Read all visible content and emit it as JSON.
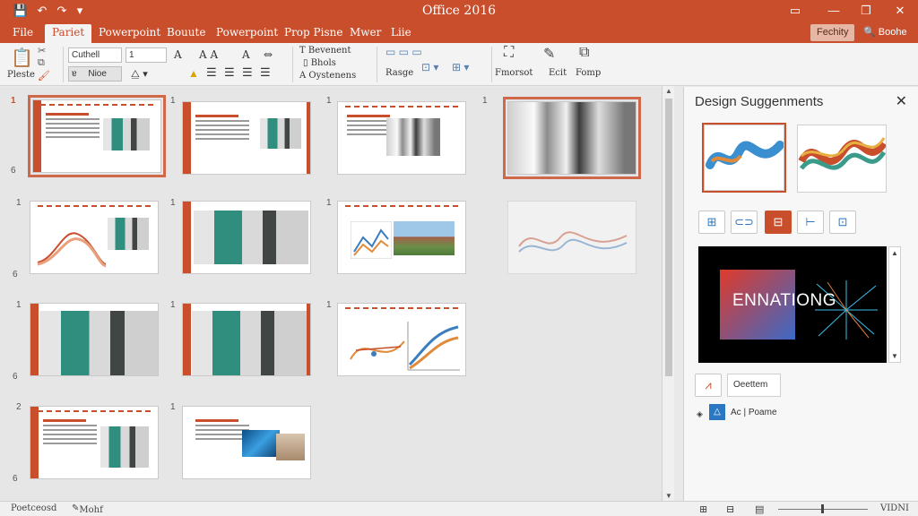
{
  "titlebar": {
    "title": "Office 2016",
    "qa_save": "💾",
    "qa_undo": "↶",
    "qa_redo": "↷",
    "qa_more": "▾",
    "win_ribbon": "▭",
    "win_min": "—",
    "win_max": "❐",
    "win_close": "✕"
  },
  "tabs": [
    {
      "label": "File"
    },
    {
      "label": "Pariet"
    },
    {
      "label": "Powerpoint"
    },
    {
      "label": "Bouute"
    },
    {
      "label": "Powerpoint"
    },
    {
      "label": "Prop Pisne"
    },
    {
      "label": "Mwer"
    },
    {
      "label": "Liie"
    }
  ],
  "account": {
    "fechity": "Fechity",
    "share": "Boohe"
  },
  "ribbon": {
    "paste_label": "Pleste",
    "font_name": "Cuthell",
    "font_size": "1",
    "format_a": "ɐ",
    "format_b": "Nioe",
    "text_dir": "Bevenent",
    "align_text": "Bhols",
    "smartart": "Oystenens",
    "shapes": "Rasge",
    "find": "Fmorsot",
    "ecit": "Ecit",
    "fomp": "Fomp"
  },
  "slides": [
    {
      "num": "1",
      "caption": ""
    },
    {
      "num": "1",
      "caption": ""
    },
    {
      "num": "1",
      "caption": ""
    },
    {
      "num": "1",
      "caption": ""
    },
    {
      "num": "1",
      "caption": ""
    },
    {
      "num": "1",
      "caption": ""
    },
    {
      "num": "1",
      "caption": ""
    },
    {
      "num": "",
      "caption": ""
    },
    {
      "num": "1",
      "caption": ""
    },
    {
      "num": "1",
      "caption": ""
    },
    {
      "num": "1",
      "caption": ""
    },
    {
      "num": "2",
      "caption": ""
    },
    {
      "num": "1",
      "caption": ""
    }
  ],
  "row_numbers": [
    "6",
    "6",
    "6",
    "6"
  ],
  "pane": {
    "title": "Design Suggenments",
    "close": "✕",
    "preview_title": "ENNATIONG",
    "option_1": "Oeettem",
    "option_2": "Ac | Poame"
  },
  "status": {
    "left": "Poetceosd",
    "notes": "Mohf",
    "zoom_label": "VIDNI"
  },
  "colors": {
    "accent": "#c94e2c",
    "ribbon_bg": "#f3f3f3"
  }
}
